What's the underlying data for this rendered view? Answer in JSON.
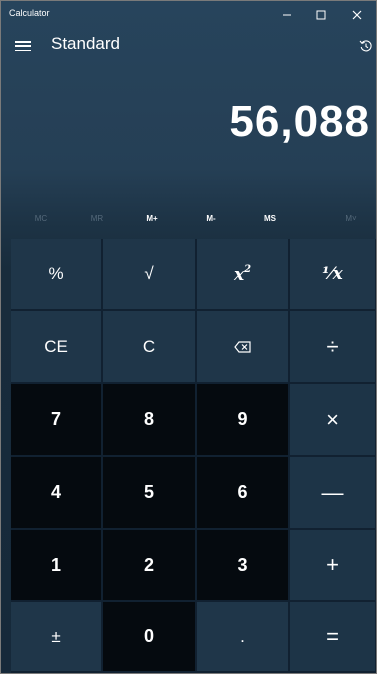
{
  "window": {
    "title": "Calculator",
    "controls": {
      "minimize": "–",
      "maximize": "☐",
      "close": "✕"
    }
  },
  "header": {
    "mode": "Standard"
  },
  "display": {
    "value": "56,088"
  },
  "memory": {
    "mc": "MC",
    "mr": "MR",
    "mplus": "M+",
    "mminus": "M-",
    "ms": "MS",
    "mlist": "M˅"
  },
  "keys": {
    "percent": "%",
    "sqrt": "√",
    "square_base": "x",
    "square_exp": "2",
    "reciprocal": "⅟x",
    "ce": "CE",
    "c": "C",
    "backspace": "⌫",
    "divide": "÷",
    "seven": "7",
    "eight": "8",
    "nine": "9",
    "multiply": "×",
    "four": "4",
    "five": "5",
    "six": "6",
    "subtract": "—",
    "one": "1",
    "two": "2",
    "three": "3",
    "add": "+",
    "negate": "±",
    "zero": "0",
    "decimal": ".",
    "equals": "="
  },
  "colors": {
    "digit_key": "#050a0f",
    "function_key": "#1f3649",
    "key_text": "#ffffff",
    "disabled_text": "#55697a"
  }
}
